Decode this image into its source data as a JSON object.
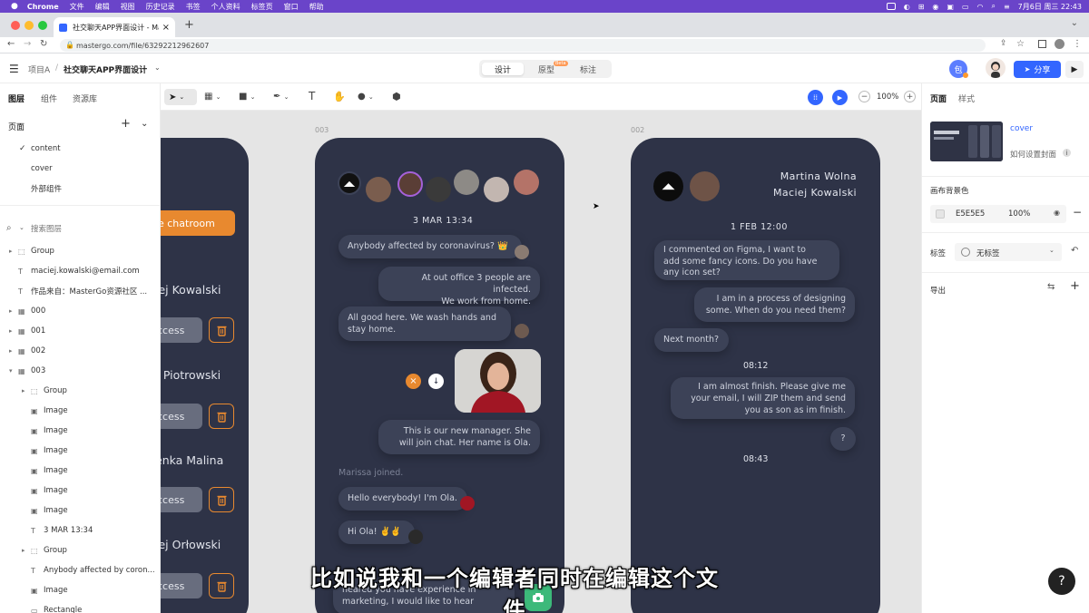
{
  "menubar": {
    "app": "Chrome",
    "items": [
      "文件",
      "编辑",
      "视图",
      "历史记录",
      "书签",
      "个人资料",
      "标签页",
      "窗口",
      "帮助"
    ],
    "datetime": "7月6日 周三 22:43"
  },
  "browser": {
    "tab_title": "社交聊天APP界面设计 - Master",
    "url": "mastergo.com/file/63292212962607"
  },
  "app": {
    "breadcrumb_project": "项目A",
    "breadcrumb_sep": "/",
    "file_title": "社交聊天APP界面设计",
    "modes": [
      "设计",
      "原型",
      "标注"
    ],
    "beta_badge": "Beta",
    "user_initial": "包",
    "share_label": "分享"
  },
  "left": {
    "tabs": [
      "图层",
      "组件",
      "资源库"
    ],
    "pages_label": "页面",
    "pages": [
      "content",
      "cover",
      "外部组件"
    ],
    "search_placeholder": "搜索图层",
    "layers": [
      {
        "name": "Group",
        "type": "group",
        "indent": 1,
        "expand": "closed"
      },
      {
        "name": "maciej.kowalski@email.com",
        "type": "text",
        "indent": 1,
        "expand": "none"
      },
      {
        "name": "作品来自：MasterGo资源社区 ...",
        "type": "text",
        "indent": 1,
        "expand": "none"
      },
      {
        "name": "000",
        "type": "frame",
        "indent": 1,
        "expand": "closed"
      },
      {
        "name": "001",
        "type": "frame",
        "indent": 1,
        "expand": "closed"
      },
      {
        "name": "002",
        "type": "frame",
        "indent": 1,
        "expand": "closed"
      },
      {
        "name": "003",
        "type": "frame",
        "indent": 1,
        "expand": "open"
      },
      {
        "name": "Group",
        "type": "group",
        "indent": 2,
        "expand": "closed"
      },
      {
        "name": "Image",
        "type": "image",
        "indent": 2,
        "expand": "none"
      },
      {
        "name": "Image",
        "type": "image",
        "indent": 2,
        "expand": "none"
      },
      {
        "name": "Image",
        "type": "image",
        "indent": 2,
        "expand": "none"
      },
      {
        "name": "Image",
        "type": "image",
        "indent": 2,
        "expand": "none"
      },
      {
        "name": "Image",
        "type": "image",
        "indent": 2,
        "expand": "none"
      },
      {
        "name": "Image",
        "type": "image",
        "indent": 2,
        "expand": "none"
      },
      {
        "name": "3 MAR 13:34",
        "type": "text",
        "indent": 2,
        "expand": "none"
      },
      {
        "name": "Group",
        "type": "group",
        "indent": 2,
        "expand": "closed"
      },
      {
        "name": "Anybody affected by coron...",
        "type": "text",
        "indent": 2,
        "expand": "none"
      },
      {
        "name": "Image",
        "type": "image",
        "indent": 2,
        "expand": "none"
      },
      {
        "name": "Rectangle",
        "type": "rect",
        "indent": 2,
        "expand": "none"
      }
    ]
  },
  "toolbar": {
    "zoom": "100%"
  },
  "canvas": {
    "frame_003_label": "003",
    "frame_002_label": "002",
    "left_phone": {
      "button": "e chatroom",
      "names": [
        "iej Kowalski",
        "t Piotrowski",
        "enka Malina",
        "iej Orłowski"
      ],
      "access": "ccess"
    },
    "mid_phone": {
      "date": "3 MAR 13:34",
      "m1": "Anybody affected by coronavirus? 👑",
      "m2a": "At out office 3 people are infected.",
      "m2b": "We work from home.",
      "m3a": "All good here. We wash hands and",
      "m3b": "stay home.",
      "m4a": "This is our new manager. She",
      "m4b": "will join chat. Her name is Ola.",
      "joined": "Marissa joined.",
      "m5": "Hello everybody! I'm Ola.",
      "m6": "Hi Ola! ✌️✌️",
      "m7a": "heared you have experience in",
      "m7b": "marketing, I would like to hear"
    },
    "right_phone": {
      "name1": "Martina Wolna",
      "name2": "Maciej Kowalski",
      "date": "1 FEB 12:00",
      "m1a": "I commented on Figma, I want to",
      "m1b": "add some fancy icons. Do you have",
      "m1c": "any icon set?",
      "m2a": "I am in a process of designing",
      "m2b": "some. When do you need them?",
      "m3": "Next month?",
      "time2": "08:12",
      "m4a": "I am almost finish. Please give me",
      "m4b": "your email, I will ZIP them and send",
      "m4c": "you as son as im finish.",
      "m5": "?",
      "time3": "08:43"
    },
    "subtitle": "比如说我和一个编辑者同时在编辑这个文件"
  },
  "right": {
    "tabs": [
      "页面",
      "样式"
    ],
    "cover_label": "cover",
    "cover_help": "如何设置封面",
    "bg_label": "画布背景色",
    "bg_hex": "E5E5E5",
    "bg_opacity": "100%",
    "tag_label": "标签",
    "tag_value": "无标签",
    "export_label": "导出"
  },
  "help_symbol": "?",
  "colors": {
    "accent": "#3366ff",
    "menubar": "#6a44c9",
    "phone": "#2e3347",
    "bubble": "#3c4257",
    "orange": "#e8892f"
  }
}
